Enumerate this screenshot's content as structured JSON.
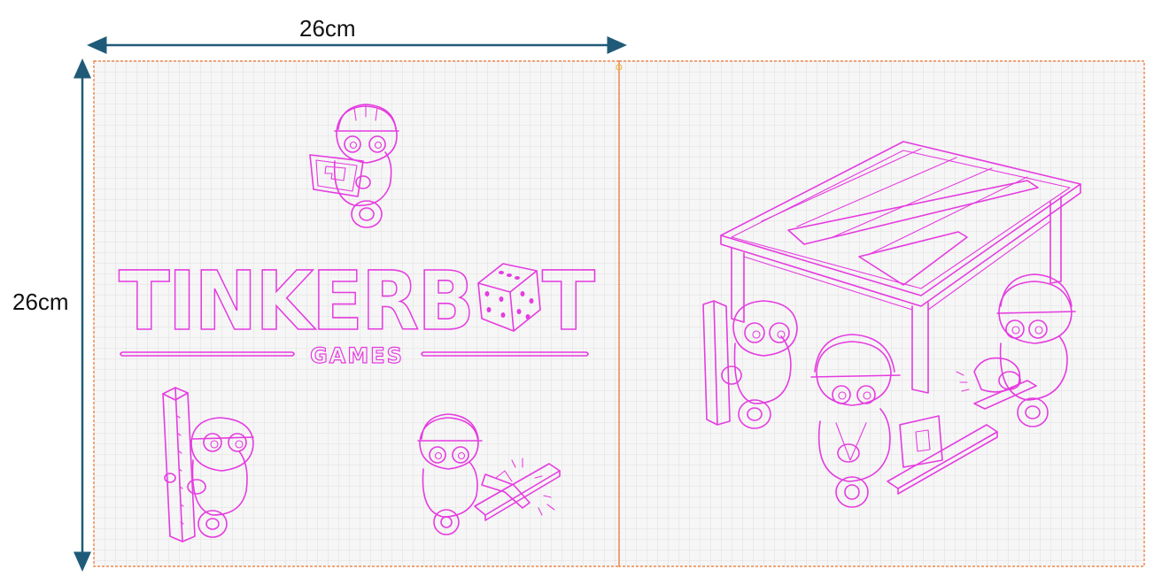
{
  "dimensions": {
    "width_label": "26cm",
    "height_label": "26cm"
  },
  "logo": {
    "title": "TINKERBOT",
    "subtitle": "GAMES"
  },
  "colors": {
    "line_art": "#e53ce0",
    "cut_outline": "#e8722c",
    "grid": "#d9d9d9",
    "dimension_arrow": "#1f5b78"
  },
  "icons": [
    "robot-tablet-icon",
    "robot-plank-icon",
    "robot-saw-icon",
    "dice-icon",
    "table-icon",
    "robot-group-icon"
  ]
}
